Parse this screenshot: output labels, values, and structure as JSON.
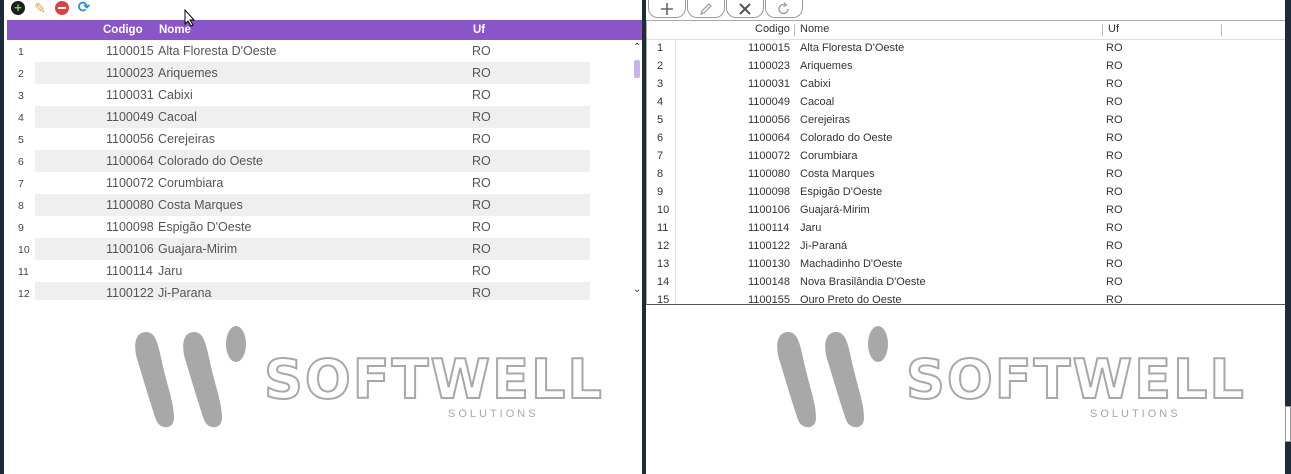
{
  "left_toolbar": {
    "icons": [
      "add-icon",
      "edit-icon",
      "delete-icon",
      "refresh-icon"
    ]
  },
  "left_grid": {
    "headers": {
      "codigo": "Codigo",
      "nome": "Nome",
      "uf": "Uf"
    },
    "header_color": "#8a55c8",
    "rows": [
      {
        "n": "1",
        "codigo": "1100015",
        "nome": "Alta Floresta D'Oeste",
        "uf": "RO"
      },
      {
        "n": "2",
        "codigo": "1100023",
        "nome": "Ariquemes",
        "uf": "RO"
      },
      {
        "n": "3",
        "codigo": "1100031",
        "nome": "Cabixi",
        "uf": "RO"
      },
      {
        "n": "4",
        "codigo": "1100049",
        "nome": "Cacoal",
        "uf": "RO"
      },
      {
        "n": "5",
        "codigo": "1100056",
        "nome": "Cerejeiras",
        "uf": "RO"
      },
      {
        "n": "6",
        "codigo": "1100064",
        "nome": "Colorado do Oeste",
        "uf": "RO"
      },
      {
        "n": "7",
        "codigo": "1100072",
        "nome": "Corumbiara",
        "uf": "RO"
      },
      {
        "n": "8",
        "codigo": "1100080",
        "nome": "Costa Marques",
        "uf": "RO"
      },
      {
        "n": "9",
        "codigo": "1100098",
        "nome": "Espigão D'Oeste",
        "uf": "RO"
      },
      {
        "n": "10",
        "codigo": "1100106",
        "nome": "Guajara-Mirim",
        "uf": "RO"
      },
      {
        "n": "11",
        "codigo": "1100114",
        "nome": "Jaru",
        "uf": "RO"
      },
      {
        "n": "12",
        "codigo": "1100122",
        "nome": "Ji-Parana",
        "uf": "RO"
      }
    ]
  },
  "right_toolbar": {
    "icons": [
      "add-icon",
      "edit-icon",
      "delete-icon",
      "refresh-icon"
    ]
  },
  "right_grid": {
    "headers": {
      "codigo": "Codigo",
      "nome": "Nome",
      "uf": "Uf"
    },
    "rows": [
      {
        "n": "1",
        "codigo": "1100015",
        "nome": "Alta Floresta D'Oeste",
        "uf": "RO"
      },
      {
        "n": "2",
        "codigo": "1100023",
        "nome": "Ariquemes",
        "uf": "RO"
      },
      {
        "n": "3",
        "codigo": "1100031",
        "nome": "Cabixi",
        "uf": "RO"
      },
      {
        "n": "4",
        "codigo": "1100049",
        "nome": "Cacoal",
        "uf": "RO"
      },
      {
        "n": "5",
        "codigo": "1100056",
        "nome": "Cerejeiras",
        "uf": "RO"
      },
      {
        "n": "6",
        "codigo": "1100064",
        "nome": "Colorado do Oeste",
        "uf": "RO"
      },
      {
        "n": "7",
        "codigo": "1100072",
        "nome": "Corumbiara",
        "uf": "RO"
      },
      {
        "n": "8",
        "codigo": "1100080",
        "nome": "Costa Marques",
        "uf": "RO"
      },
      {
        "n": "9",
        "codigo": "1100098",
        "nome": "Espigão D'Oeste",
        "uf": "RO"
      },
      {
        "n": "10",
        "codigo": "1100106",
        "nome": "Guajará-Mirim",
        "uf": "RO"
      },
      {
        "n": "11",
        "codigo": "1100114",
        "nome": "Jaru",
        "uf": "RO"
      },
      {
        "n": "12",
        "codigo": "1100122",
        "nome": "Ji-Paraná",
        "uf": "RO"
      },
      {
        "n": "13",
        "codigo": "1100130",
        "nome": "Machadinho D'Oeste",
        "uf": "RO"
      },
      {
        "n": "14",
        "codigo": "1100148",
        "nome": "Nova Brasilândia D'Oeste",
        "uf": "RO"
      },
      {
        "n": "15",
        "codigo": "1100155",
        "nome": "Ouro Preto do Oeste",
        "uf": "RO"
      }
    ]
  },
  "logo": {
    "name": "SOFTWELL",
    "tagline": "SOLUTIONS",
    "color": "#a8a8a8"
  }
}
